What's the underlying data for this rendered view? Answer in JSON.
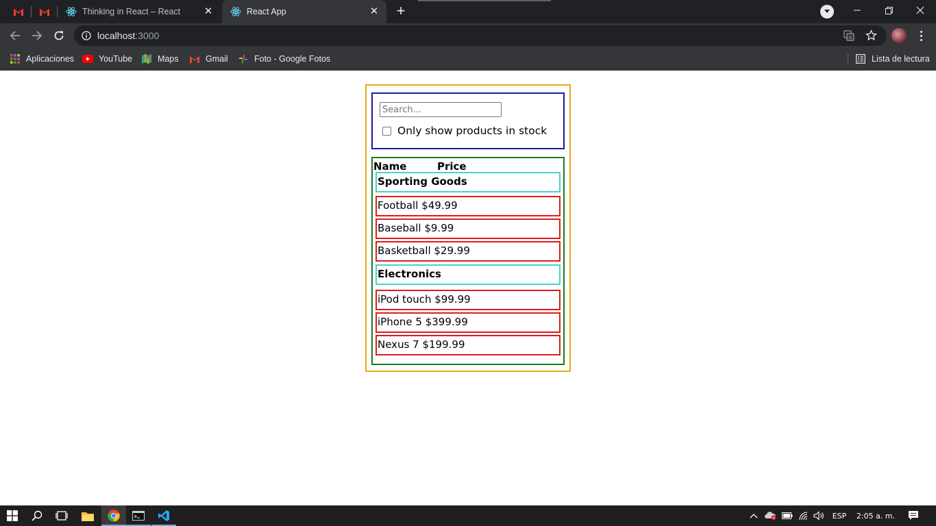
{
  "browser": {
    "tabs": [
      {
        "title": "Thinking in React – React",
        "active": false
      },
      {
        "title": "React App",
        "active": true
      }
    ],
    "url_host": "localhost",
    "url_port": ":3000",
    "bookmarks": [
      {
        "label": "Aplicaciones",
        "icon": "apps-grid-icon"
      },
      {
        "label": "YouTube",
        "icon": "youtube-icon"
      },
      {
        "label": "Maps",
        "icon": "maps-icon"
      },
      {
        "label": "Gmail",
        "icon": "gmail-icon"
      },
      {
        "label": "Foto - Google Fotos",
        "icon": "google-photos-icon"
      }
    ],
    "reading_list": "Lista de lectura"
  },
  "app": {
    "search_placeholder": "Search...",
    "in_stock_label": "Only show products in stock",
    "in_stock_checked": false,
    "table_header": {
      "name": "Name",
      "price": "Price"
    },
    "categories": [
      {
        "name": "Sporting Goods",
        "products": [
          "Football $49.99",
          "Baseball $9.99",
          "Basketball $29.99"
        ]
      },
      {
        "name": "Electronics",
        "products": [
          "iPod touch $99.99",
          "iPhone 5 $399.99",
          "Nexus 7 $199.99"
        ]
      }
    ],
    "colors": {
      "filterable_table_border": "#e6a817",
      "search_bar_border": "#1a1aa8",
      "product_table_border": "#1a7a1a",
      "category_row_border": "#48d1cc",
      "product_row_border": "#dd1c1c"
    }
  },
  "taskbar": {
    "language": "ESP",
    "clock": "2:05 a. m."
  }
}
